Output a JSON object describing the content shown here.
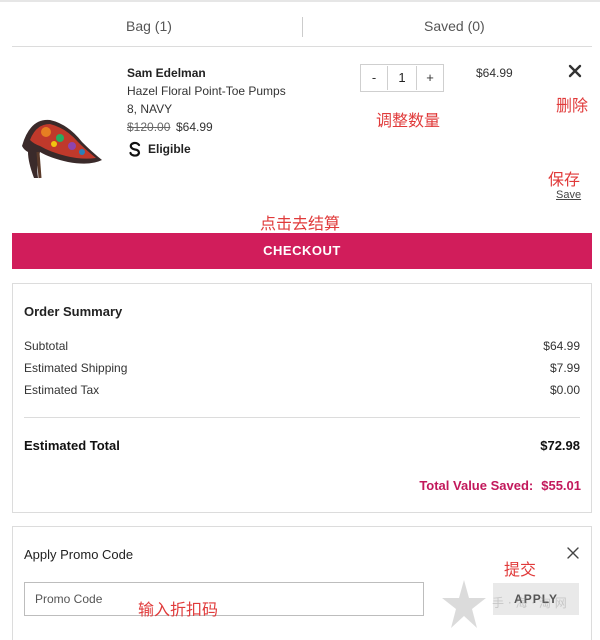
{
  "tabs": {
    "bag_label": "Bag (1)",
    "saved_label": "Saved (0)"
  },
  "item": {
    "brand": "Sam Edelman",
    "name": "Hazel Floral Point-Toe Pumps",
    "variant": "8, NAVY",
    "original_price": "$120.00",
    "sale_price": "$64.99",
    "eligible_label": "Eligible",
    "quantity": "1",
    "qty_decrease": "-",
    "qty_increase": "+",
    "line_price": "$64.99",
    "save_label": "Save"
  },
  "annotations": {
    "adjust_qty": "调整数量",
    "remove": "删除",
    "save": "保存",
    "checkout": "点击去结算",
    "submit": "提交",
    "enter_promo": "输入折扣码"
  },
  "checkout_label": "CHECKOUT",
  "summary": {
    "title": "Order Summary",
    "subtotal_label": "Subtotal",
    "subtotal_value": "$64.99",
    "shipping_label": "Estimated Shipping",
    "shipping_value": "$7.99",
    "tax_label": "Estimated Tax",
    "tax_value": "$0.00",
    "total_label": "Estimated Total",
    "total_value": "$72.98",
    "saved_label": "Total Value Saved:",
    "saved_value": "$55.01"
  },
  "promo": {
    "title": "Apply Promo Code",
    "placeholder": "Promo Code",
    "apply_label": "APPLY"
  },
  "watermark_text": "手 · 海 · 淘 网",
  "colors": {
    "checkout_bg": "#d11d5b",
    "saved_text": "#c2185b",
    "annotation": "#e03a3a",
    "border": "#dcdcdc"
  },
  "icons": [
    "shoe-image",
    "eligible-icon",
    "close-icon",
    "promo-close-icon",
    "star-watermark-icon"
  ]
}
